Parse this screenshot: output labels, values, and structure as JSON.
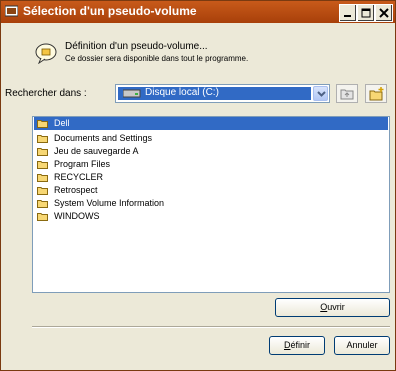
{
  "window": {
    "title": "Sélection d'un pseudo-volume"
  },
  "info": {
    "title": "Définition d'un pseudo-volume...",
    "subtitle": "Ce dossier sera disponible dans tout le programme."
  },
  "lookin": {
    "label": "Rechercher dans :",
    "selected": "Disque local (C:)"
  },
  "folders": [
    {
      "name": "Dell",
      "selected": true
    },
    {
      "name": "Documents and Settings"
    },
    {
      "name": "Jeu de sauvegarde A"
    },
    {
      "name": "Program Files"
    },
    {
      "name": "RECYCLER"
    },
    {
      "name": "Retrospect"
    },
    {
      "name": "System Volume Information"
    },
    {
      "name": "WINDOWS"
    }
  ],
  "buttons": {
    "open_label_first": "O",
    "open_label_rest": "uvrir",
    "define_label_first": "D",
    "define_label_rest": "éfinir",
    "cancel_label": "Annuler"
  },
  "icons": {
    "window": "window-icon",
    "info": "speech-bubble-icon",
    "drive": "hard-drive-icon",
    "dropdown": "chevron-down-icon",
    "up": "up-folder-icon",
    "new": "new-folder-icon",
    "folder": "folder-icon"
  },
  "colors": {
    "titlebar": "#b84d12",
    "selection": "#316ac5",
    "window_bg": "#ece9d8"
  }
}
